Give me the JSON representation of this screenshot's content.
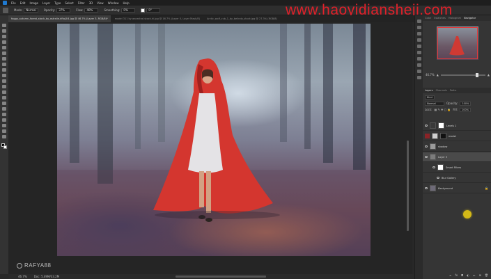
{
  "watermark": "www.haoyidiansheji.com",
  "menu": [
    "File",
    "Edit",
    "Image",
    "Layer",
    "Type",
    "Select",
    "Filter",
    "3D",
    "View",
    "Window",
    "Help"
  ],
  "options": {
    "mode_label": "Mode:",
    "mode_value": "Normal",
    "opacity_label": "Opacity:",
    "opacity_value": "37%",
    "flow_label": "Flow:",
    "flow_value": "40%",
    "smoothing_label": "Smoothing:",
    "smoothing_value": "0%",
    "angle_value": "0°"
  },
  "tabs": [
    {
      "label": "foggy_autumn_forest_stock_by_astralie-dfbq2l4.jpg @ 46.7% (Layer 3, RGB/8)*",
      "active": true
    },
    {
      "label": "model 311 by ancestral-stock-hi.jpg @ 16.7% (Layer 0, Layer Mask/8)",
      "active": false
    },
    {
      "label": "Arctic_wolf_cub_1_by_belinda_stock.jpg @ 27.3% (RGB/8)",
      "active": false
    }
  ],
  "navigator": {
    "tabs": [
      "Color",
      "Swatches",
      "Histogram",
      "Navigator"
    ],
    "zoom": "46.7%"
  },
  "layers_panel": {
    "tabs": [
      "Layers",
      "Channels",
      "Paths"
    ],
    "kind_label": "Kind",
    "blend_mode": "Normal",
    "opacity_label": "Opacity:",
    "opacity_value": "100%",
    "lock_label": "Lock:",
    "fill_label": "Fill:",
    "fill_value": "100%",
    "layers": [
      {
        "name": "Levels 1",
        "selected": false,
        "type": "adjustment"
      },
      {
        "name": "model",
        "selected": false,
        "type": "masked",
        "color_tag": "#8a2327"
      },
      {
        "name": "shadow",
        "selected": false,
        "type": "pixel"
      },
      {
        "name": "Layer 3",
        "selected": true,
        "type": "smart"
      },
      {
        "name": "Smart Filters",
        "selected": false,
        "type": "filter-mask"
      },
      {
        "name": "Blur Gallery",
        "selected": false,
        "type": "filter"
      },
      {
        "name": "Background",
        "selected": false,
        "type": "background",
        "italic": true
      }
    ]
  },
  "status": {
    "zoom": "46.7%",
    "doc_size": "Doc: 5.49M/33.2M"
  },
  "brand": "RAFYA88"
}
